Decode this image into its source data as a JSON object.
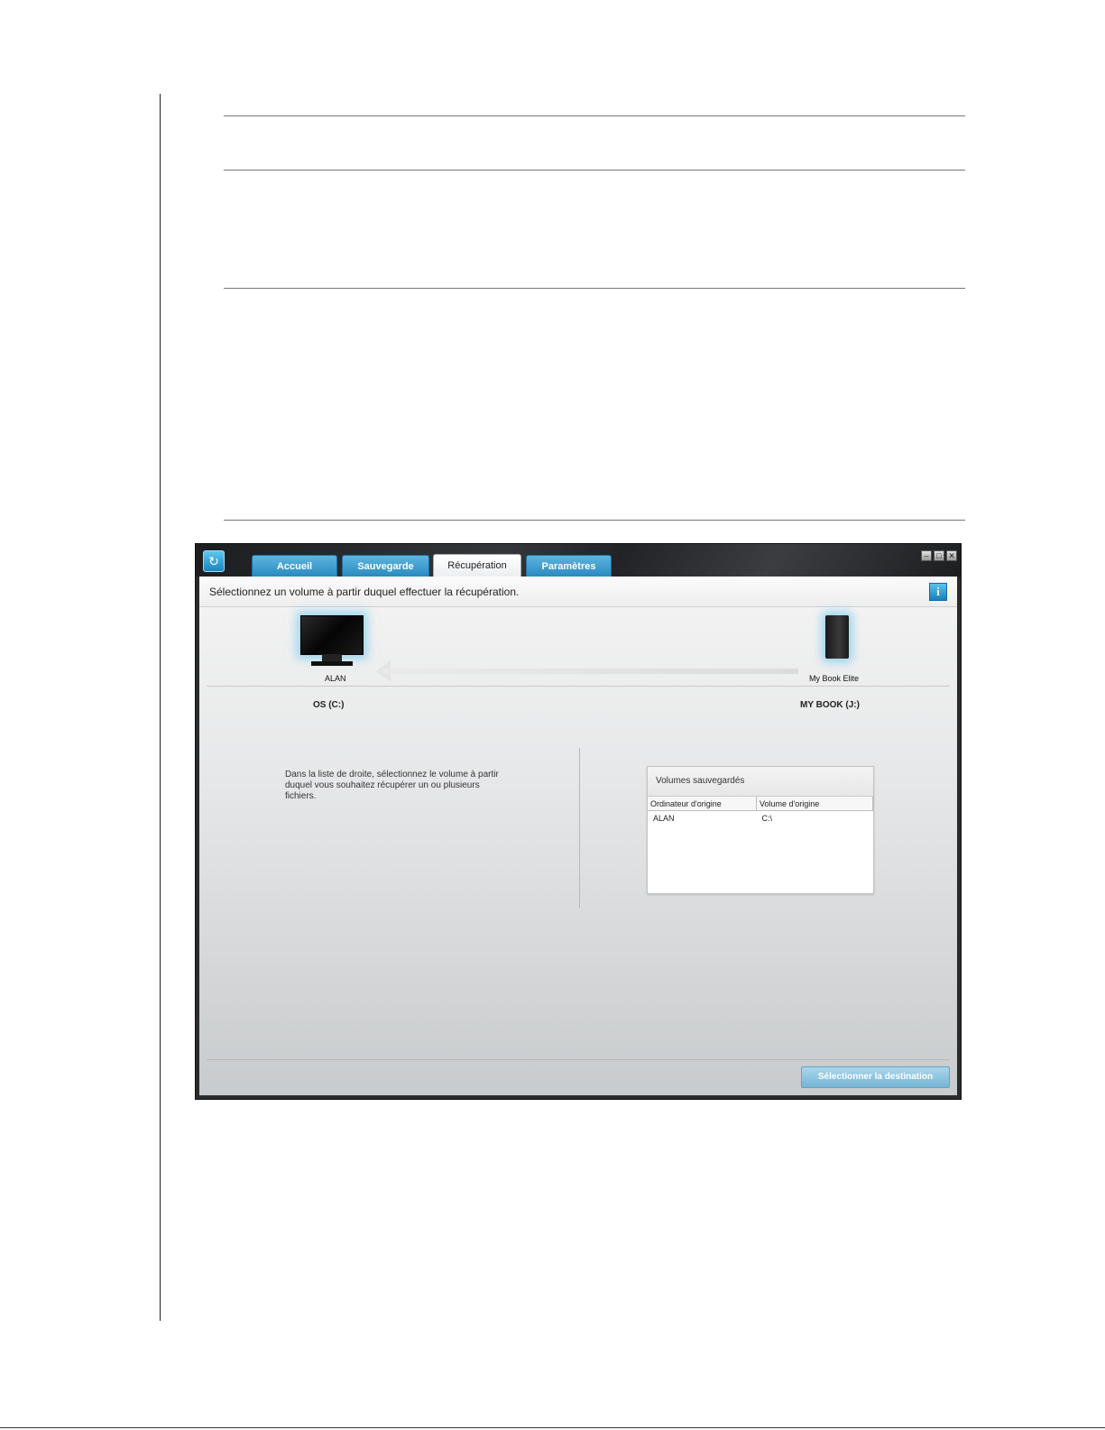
{
  "app": {
    "tabs": [
      {
        "label": "Accueil"
      },
      {
        "label": "Sauvegarde"
      },
      {
        "label": "Récupération"
      },
      {
        "label": "Paramètres"
      }
    ],
    "instruction": "Sélectionnez un volume à partir duquel effectuer la récupération.",
    "info_label": "i",
    "source_device": {
      "name": "ALAN",
      "volume": "OS (C:)"
    },
    "target_device": {
      "name": "My Book Elite",
      "volume": "MY BOOK (J:)"
    },
    "hint": "Dans la liste de droite, sélectionnez le volume à partir duquel vous souhaitez récupérer un ou plusieurs fichiers.",
    "volumes_panel": {
      "title": "Volumes sauvegardés",
      "columns": [
        "Ordinateur d'origine",
        "Volume d'origine"
      ],
      "rows": [
        {
          "computer": "ALAN",
          "volume": "C:\\"
        }
      ]
    },
    "select_destination_label": "Sélectionner la destination"
  }
}
